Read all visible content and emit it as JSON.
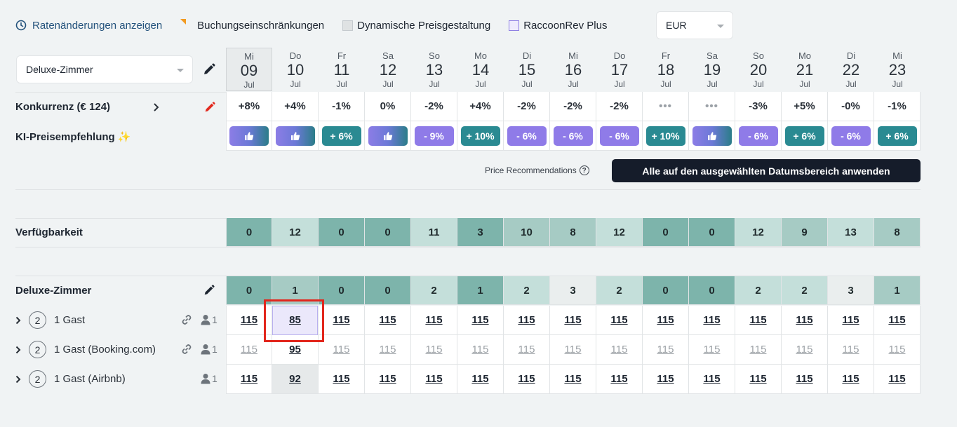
{
  "legend": {
    "rate_changes": "Ratenänderungen anzeigen",
    "booking_restrictions": "Buchungseinschränkungen",
    "dynamic_pricing": "Dynamische Preisgestaltung",
    "raccoonrev_plus": "RaccoonRev Plus",
    "currency": "EUR"
  },
  "room_select": {
    "value": "Deluxe-Zimmer"
  },
  "dates": [
    {
      "dow": "Mi",
      "day": "09",
      "mon": "Jul"
    },
    {
      "dow": "Do",
      "day": "10",
      "mon": "Jul"
    },
    {
      "dow": "Fr",
      "day": "11",
      "mon": "Jul"
    },
    {
      "dow": "Sa",
      "day": "12",
      "mon": "Jul"
    },
    {
      "dow": "So",
      "day": "13",
      "mon": "Jul"
    },
    {
      "dow": "Mo",
      "day": "14",
      "mon": "Jul"
    },
    {
      "dow": "Di",
      "day": "15",
      "mon": "Jul"
    },
    {
      "dow": "Mi",
      "day": "16",
      "mon": "Jul"
    },
    {
      "dow": "Do",
      "day": "17",
      "mon": "Jul"
    },
    {
      "dow": "Fr",
      "day": "18",
      "mon": "Jul"
    },
    {
      "dow": "Sa",
      "day": "19",
      "mon": "Jul"
    },
    {
      "dow": "So",
      "day": "20",
      "mon": "Jul"
    },
    {
      "dow": "Mo",
      "day": "21",
      "mon": "Jul"
    },
    {
      "dow": "Di",
      "day": "22",
      "mon": "Jul"
    },
    {
      "dow": "Mi",
      "day": "23",
      "mon": "Jul"
    }
  ],
  "competition": {
    "label": "Konkurrenz (€ 124)",
    "values": [
      "+8%",
      "+4%",
      "-1%",
      "0%",
      "-2%",
      "+4%",
      "-2%",
      "-2%",
      "-2%",
      "•••",
      "•••",
      "-3%",
      "+5%",
      "-0%",
      "-1%"
    ]
  },
  "ai_recommendation": {
    "label": "KI-Preisempfehlung ✨",
    "pills": [
      {
        "type": "thumb",
        "text": ""
      },
      {
        "type": "thumb",
        "text": ""
      },
      {
        "type": "up",
        "text": "+ 6%"
      },
      {
        "type": "thumb",
        "text": ""
      },
      {
        "type": "down",
        "text": "- 9%"
      },
      {
        "type": "up",
        "text": "+ 10%"
      },
      {
        "type": "down",
        "text": "- 6%"
      },
      {
        "type": "down",
        "text": "- 6%"
      },
      {
        "type": "down",
        "text": "- 6%"
      },
      {
        "type": "up",
        "text": "+ 10%"
      },
      {
        "type": "thumb",
        "text": ""
      },
      {
        "type": "down",
        "text": "- 6%"
      },
      {
        "type": "up",
        "text": "+ 6%"
      },
      {
        "type": "down",
        "text": "- 6%"
      },
      {
        "type": "up",
        "text": "+ 6%"
      }
    ]
  },
  "price_recommendations_label": "Price Recommendations",
  "apply_button": "Alle auf den ausgewählten Datumsbereich anwenden",
  "availability": {
    "label": "Verfügbarkeit",
    "values": [
      "0",
      "12",
      "0",
      "0",
      "11",
      "3",
      "10",
      "8",
      "12",
      "0",
      "0",
      "12",
      "9",
      "13",
      "8"
    ],
    "levels": [
      0,
      2,
      0,
      0,
      2,
      0,
      1,
      1,
      2,
      0,
      0,
      2,
      1,
      2,
      1
    ]
  },
  "room": {
    "label": "Deluxe-Zimmer",
    "values": [
      "0",
      "1",
      "0",
      "0",
      "2",
      "1",
      "2",
      "3",
      "2",
      "0",
      "0",
      "2",
      "2",
      "3",
      "1"
    ],
    "levels": [
      0,
      1,
      0,
      0,
      2,
      0,
      2,
      3,
      2,
      0,
      0,
      2,
      2,
      3,
      1
    ]
  },
  "rates": [
    {
      "occupancy": "2",
      "name": "1 Gast",
      "linked": true,
      "guests": "1",
      "prices": [
        "115",
        "85",
        "115",
        "115",
        "115",
        "115",
        "115",
        "115",
        "115",
        "115",
        "115",
        "115",
        "115",
        "115",
        "115"
      ]
    },
    {
      "occupancy": "2",
      "name": "1 Gast (Booking.com)",
      "linked": true,
      "guests": "1",
      "prices": [
        "115",
        "95",
        "115",
        "115",
        "115",
        "115",
        "115",
        "115",
        "115",
        "115",
        "115",
        "115",
        "115",
        "115",
        "115"
      ]
    },
    {
      "occupancy": "2",
      "name": "1 Gast (Airbnb)",
      "linked": false,
      "guests": "1",
      "prices": [
        "115",
        "92",
        "115",
        "115",
        "115",
        "115",
        "115",
        "115",
        "115",
        "115",
        "115",
        "115",
        "115",
        "115",
        "115"
      ]
    }
  ],
  "colors": {
    "accent_link": "#23527c",
    "apply_button_bg": "#151c2a",
    "pill_up": "#2a8a92",
    "pill_down": "#8f7be8",
    "highlight_box": "#e2261c"
  },
  "icons": {
    "rate_changes": "clock-icon",
    "edit": "pencil-icon",
    "edit_competition": "red-pencil-icon",
    "expand": "chevron-right-icon",
    "link": "link-icon",
    "guest": "person-icon",
    "thumb": "thumbs-up-icon",
    "help": "question-circle-icon"
  }
}
